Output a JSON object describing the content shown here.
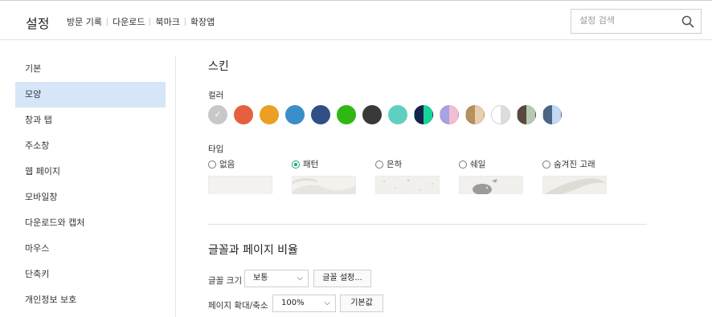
{
  "header": {
    "title": "설정",
    "nav": [
      "방문 기록",
      "다운로드",
      "북마크",
      "확장앱"
    ],
    "search_placeholder": "설정 검색"
  },
  "sidebar": {
    "items": [
      {
        "label": "기본"
      },
      {
        "label": "모양"
      },
      {
        "label": "창과 탭"
      },
      {
        "label": "주소창"
      },
      {
        "label": "웹 페이지"
      },
      {
        "label": "모바일창"
      },
      {
        "label": "다운로드와 캡처"
      },
      {
        "label": "마우스"
      },
      {
        "label": "단축키"
      },
      {
        "label": "개인정보 보호"
      }
    ],
    "active_index": 1
  },
  "skin": {
    "title": "스킨",
    "color_label": "컬러",
    "colors": [
      {
        "name": "gray",
        "a": "#c8c8c8",
        "b": "#c8c8c8",
        "selected": true
      },
      {
        "name": "red",
        "a": "#e5603f",
        "b": "#e5603f"
      },
      {
        "name": "orange",
        "a": "#eba024",
        "b": "#eba024"
      },
      {
        "name": "blue",
        "a": "#3b8fc8",
        "b": "#3b8fc8"
      },
      {
        "name": "navy",
        "a": "#2f4f85",
        "b": "#2f4f85"
      },
      {
        "name": "green",
        "a": "#2fb714",
        "b": "#2fb714"
      },
      {
        "name": "dark",
        "a": "#393939",
        "b": "#393939"
      },
      {
        "name": "mint",
        "a": "#5fcfc1",
        "b": "#5fcfc1"
      },
      {
        "name": "navy-green",
        "a": "#16244a",
        "b": "#18d49a"
      },
      {
        "name": "lavender-pink",
        "a": "#a7a2e3",
        "b": "#f3bed0"
      },
      {
        "name": "tan-beige",
        "a": "#b88f5e",
        "b": "#e6cfae"
      },
      {
        "name": "white-gray",
        "a": "#ffffff",
        "b": "#dcdcdc"
      },
      {
        "name": "brown-sage",
        "a": "#5b4840",
        "b": "#b8c9b3"
      },
      {
        "name": "slate-lightblue",
        "a": "#4b6585",
        "b": "#c3d9f2"
      }
    ],
    "type_label": "타입",
    "types": [
      {
        "label": "없음",
        "checked": false
      },
      {
        "label": "패턴",
        "checked": true
      },
      {
        "label": "은하",
        "checked": false
      },
      {
        "label": "쉐일",
        "checked": false
      },
      {
        "label": "숨겨진 고래",
        "checked": false
      }
    ]
  },
  "font": {
    "title": "글꼴과 페이지 비율",
    "size_label": "글꼴 크기",
    "size_value": "보통",
    "font_settings_button": "글꼴 설정...",
    "zoom_label": "페이지 확대/축소",
    "zoom_value": "100%",
    "default_button": "기본값"
  }
}
